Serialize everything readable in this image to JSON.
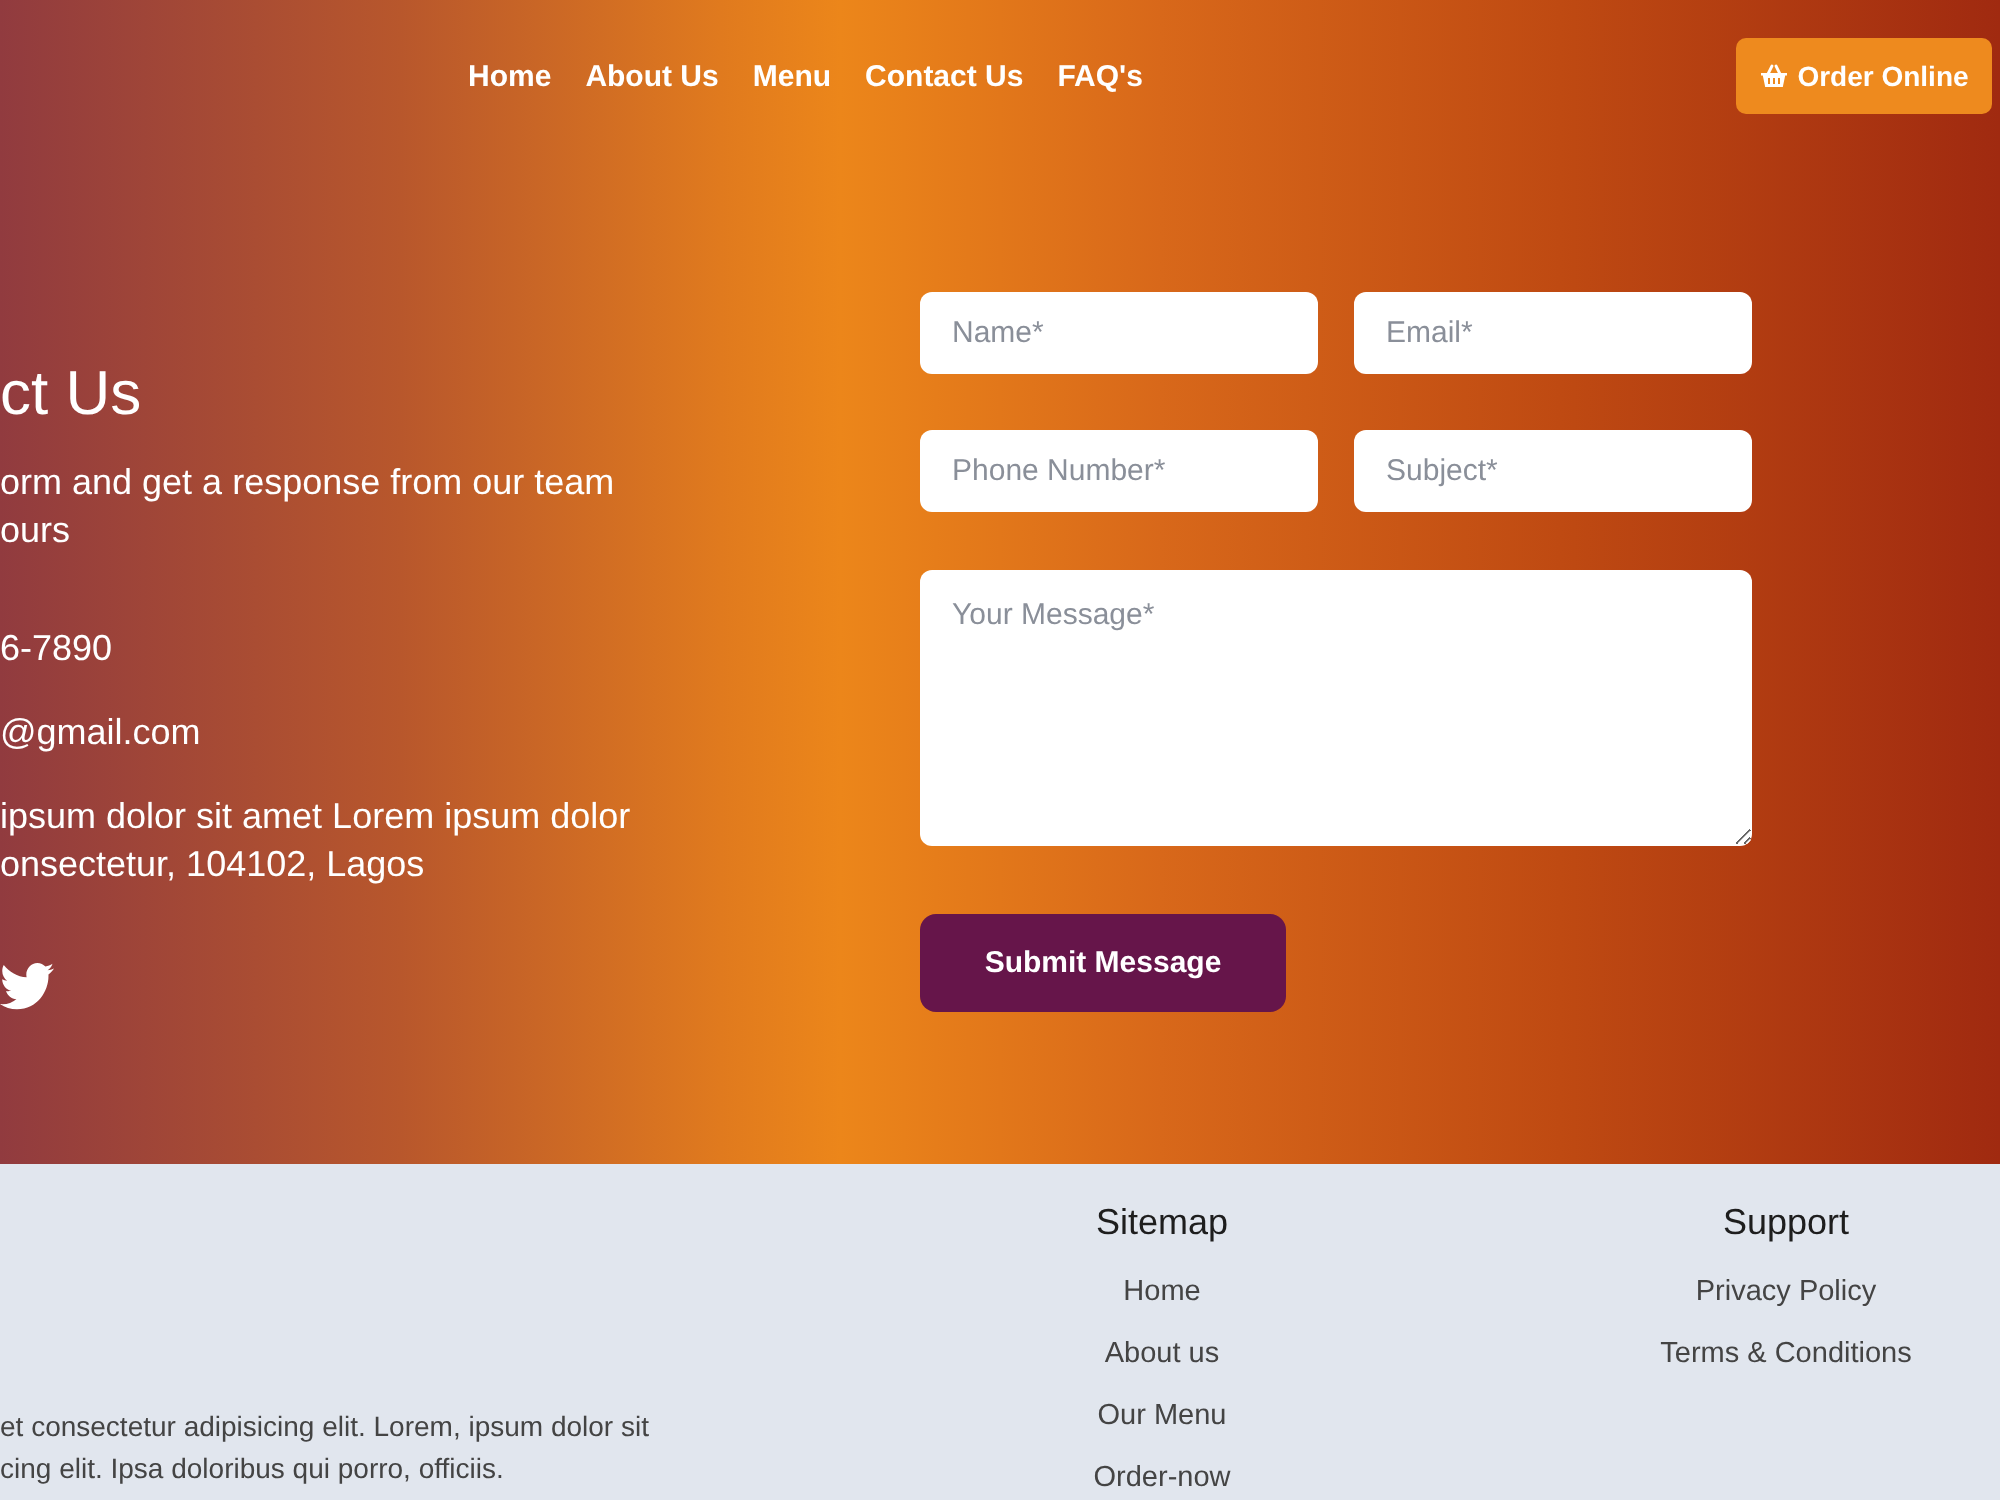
{
  "nav": {
    "links": [
      {
        "label": "Home"
      },
      {
        "label": "About Us"
      },
      {
        "label": "Menu"
      },
      {
        "label": "Contact Us"
      },
      {
        "label": "FAQ's"
      }
    ],
    "order_button": {
      "label": "Order Online"
    }
  },
  "contact": {
    "heading": "ct Us",
    "intro_lines": [
      "orm and get a response from our team",
      "ours"
    ],
    "phone": "6-7890",
    "email": "@gmail.com",
    "address_lines": [
      "ipsum dolor sit amet Lorem ipsum dolor",
      "onsectetur, 104102, Lagos"
    ],
    "social": [
      {
        "kind": "twitter"
      }
    ]
  },
  "form": {
    "fields": [
      {
        "placeholder": "Name*"
      },
      {
        "placeholder": "Email*"
      },
      {
        "placeholder": "Phone Number*"
      },
      {
        "placeholder": "Subject*"
      }
    ],
    "message": {
      "placeholder": "Your Message*"
    },
    "submit": "Submit Message"
  },
  "footer": {
    "about_lines": [
      "et consectetur adipisicing elit. Lorem, ipsum dolor sit",
      "cing elit. Ipsa doloribus qui porro, officiis."
    ],
    "columns": [
      {
        "title": "Sitemap",
        "links": [
          "Home",
          "About us",
          "Our Menu",
          "Order-now"
        ]
      },
      {
        "title": "Support",
        "links": [
          "Privacy Policy",
          "Terms & Conditions"
        ]
      }
    ]
  }
}
